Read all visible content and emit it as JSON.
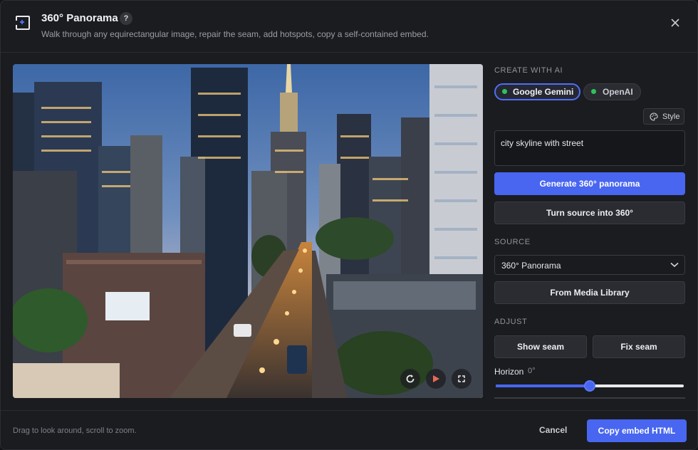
{
  "header": {
    "title": "360° Panorama",
    "help_label": "?",
    "subtitle": "Walk through any equirectangular image, repair the seam, add hotspots, copy a self-contained embed.",
    "close_icon": "close-icon"
  },
  "viewer": {
    "scene": "city skyline at dusk",
    "controls": [
      "rotate-icon",
      "play-icon",
      "fullscreen-icon"
    ]
  },
  "create_ai": {
    "label": "CREATE WITH AI",
    "providers": [
      {
        "label": "Google Gemini",
        "selected": true,
        "status_color": "#2ec25c"
      },
      {
        "label": "OpenAI",
        "selected": false,
        "status_color": "#2ec25c"
      }
    ],
    "style_label": "Style",
    "prompt_value": "city skyline with street",
    "generate_label": "Generate 360° panorama",
    "turn_source_label": "Turn source into 360°"
  },
  "source": {
    "label": "SOURCE",
    "selected": "360° Panorama",
    "media_library_label": "From Media Library"
  },
  "adjust": {
    "label": "ADJUST",
    "show_seam_label": "Show seam",
    "fix_seam_label": "Fix seam",
    "horizon_label": "Horizon",
    "horizon_value": "0°",
    "horizon_slider_fraction": 0.5
  },
  "footer": {
    "hint": "Drag to look around, scroll to zoom.",
    "cancel_label": "Cancel",
    "copy_label": "Copy embed HTML"
  },
  "colors": {
    "accent": "#4866f0",
    "background": "#1b1c20",
    "status_green": "#2ec25c"
  }
}
